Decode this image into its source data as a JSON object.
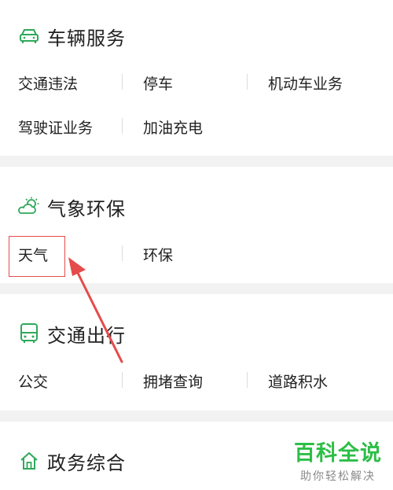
{
  "sections": [
    {
      "title": "车辆服务",
      "icon": "car-icon",
      "items": [
        "交通违法",
        "停车",
        "机动车业务",
        "驾驶证业务",
        "加油充电"
      ]
    },
    {
      "title": "气象环保",
      "icon": "weather-icon",
      "items": [
        "天气",
        "环保"
      ]
    },
    {
      "title": "交通出行",
      "icon": "bus-icon",
      "items": [
        "公交",
        "拥堵查询",
        "道路积水"
      ]
    },
    {
      "title": "政务综合",
      "icon": "home-icon",
      "items": []
    }
  ],
  "colors": {
    "accent": "#2fa85a",
    "highlight": "#e64b4b",
    "watermark": "#2dbe47"
  },
  "watermark": {
    "main": "百科全说",
    "sub": "助你轻松解决"
  }
}
